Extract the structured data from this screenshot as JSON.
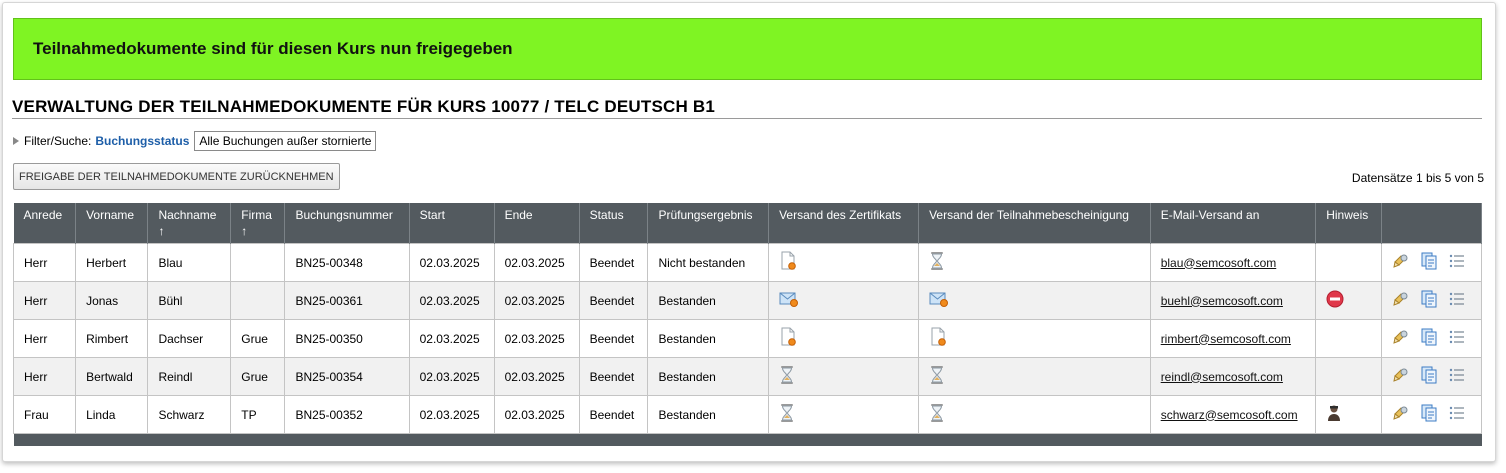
{
  "banner": {
    "text": "Teilnahmedokumente sind für diesen Kurs nun freigegeben"
  },
  "page_title": "VERWALTUNG DER TEILNAHMEDOKUMENTE FÜR KURS 10077 / TELC DEUTSCH B1",
  "filter": {
    "prefix": "Filter/Suche:",
    "key": "Buchungsstatus",
    "value": "Alle Buchungen außer stornierte"
  },
  "revoke_button": "FREIGABE DER TEILNAHMEDOKUMENTE ZURÜCKNEHMEN",
  "records_info": "Datensätze 1 bis 5 von 5",
  "columns": [
    {
      "label": "Anrede",
      "arrow": ""
    },
    {
      "label": "Vorname",
      "arrow": ""
    },
    {
      "label": "Nachname",
      "arrow": "↑"
    },
    {
      "label": "Firma",
      "arrow": "↑"
    },
    {
      "label": "Buchungsnummer",
      "arrow": ""
    },
    {
      "label": "Start",
      "arrow": ""
    },
    {
      "label": "Ende",
      "arrow": ""
    },
    {
      "label": "Status",
      "arrow": ""
    },
    {
      "label": "Prüfungsergebnis",
      "arrow": ""
    },
    {
      "label": "Versand des Zertifikats",
      "arrow": ""
    },
    {
      "label": "Versand der Teilnahmebescheinigung",
      "arrow": ""
    },
    {
      "label": "E-Mail-Versand an",
      "arrow": ""
    },
    {
      "label": "Hinweis",
      "arrow": ""
    },
    {
      "label": "",
      "arrow": ""
    }
  ],
  "rows": [
    {
      "anrede": "Herr",
      "vorname": "Herbert",
      "nachname": "Blau",
      "firma": "",
      "buchungsnummer": "BN25-00348",
      "start": "02.03.2025",
      "ende": "02.03.2025",
      "status": "Beendet",
      "ergebnis": "Nicht bestanden",
      "zertifikat_icon": "document-pending-icon",
      "bescheinigung_icon": "hourglass-icon",
      "email": "blau@semcosoft.com",
      "hinweis_icon": ""
    },
    {
      "anrede": "Herr",
      "vorname": "Jonas",
      "nachname": "Bühl",
      "firma": "",
      "buchungsnummer": "BN25-00361",
      "start": "02.03.2025",
      "ende": "02.03.2025",
      "status": "Beendet",
      "ergebnis": "Bestanden",
      "zertifikat_icon": "mail-sent-icon",
      "bescheinigung_icon": "mail-sent-icon",
      "email": "buehl@semcosoft.com",
      "hinweis_icon": "stop-icon"
    },
    {
      "anrede": "Herr",
      "vorname": "Rimbert",
      "nachname": "Dachser",
      "firma": "Grue",
      "buchungsnummer": "BN25-00350",
      "start": "02.03.2025",
      "ende": "02.03.2025",
      "status": "Beendet",
      "ergebnis": "Bestanden",
      "zertifikat_icon": "document-pending-icon",
      "bescheinigung_icon": "document-pending-icon",
      "email": "rimbert@semcosoft.com",
      "hinweis_icon": ""
    },
    {
      "anrede": "Herr",
      "vorname": "Bertwald",
      "nachname": "Reindl",
      "firma": "Grue",
      "buchungsnummer": "BN25-00354",
      "start": "02.03.2025",
      "ende": "02.03.2025",
      "status": "Beendet",
      "ergebnis": "Bestanden",
      "zertifikat_icon": "hourglass-icon",
      "bescheinigung_icon": "hourglass-icon",
      "email": "reindl@semcosoft.com",
      "hinweis_icon": ""
    },
    {
      "anrede": "Frau",
      "vorname": "Linda",
      "nachname": "Schwarz",
      "firma": "TP",
      "buchungsnummer": "BN25-00352",
      "start": "02.03.2025",
      "ende": "02.03.2025",
      "status": "Beendet",
      "ergebnis": "Bestanden",
      "zertifikat_icon": "hourglass-icon",
      "bescheinigung_icon": "hourglass-icon",
      "email": "schwarz@semcosoft.com",
      "hinweis_icon": "person-icon"
    }
  ],
  "colors": {
    "banner": "#7ff423",
    "header": "#535a5f",
    "filter_key": "#1d5ea8"
  }
}
